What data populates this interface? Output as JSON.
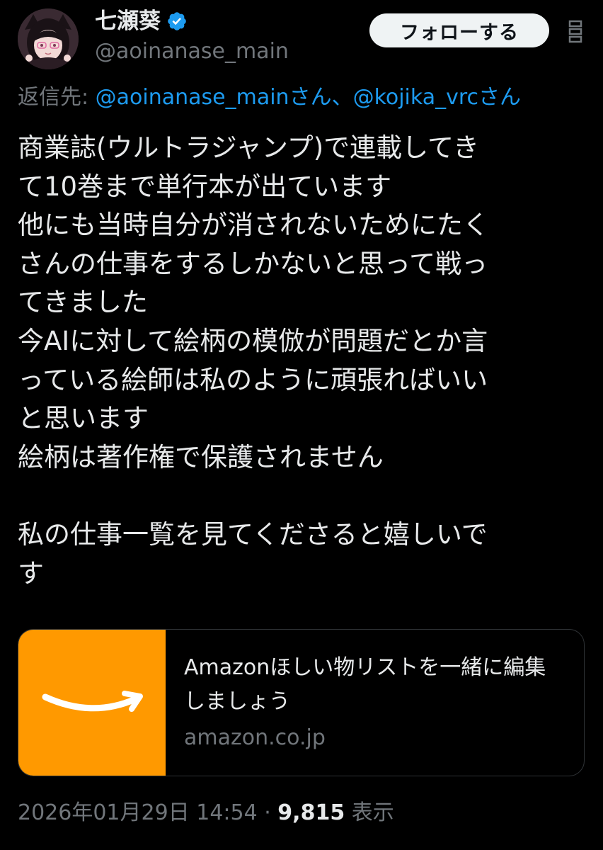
{
  "author": {
    "display_name": "七瀬葵",
    "handle": "@aoinanase_main",
    "verified": true,
    "avatar_icon": "avatar-image"
  },
  "header": {
    "follow_label": "フォローする",
    "more_icon": "more-icon"
  },
  "reply_to": {
    "prefix": "返信先: ",
    "mentions": "@aoinanase_mainさん、@kojika_vrcさん"
  },
  "tweet": {
    "text": "商業誌(ウルトラジャンプ)で連載してき\nて10巻まで単行本が出ています\n他にも当時自分が消されないためにたく\nさんの仕事をするしかないと思って戦っ\nてきました\n今AIに対して絵柄の模倣が問題だとか言\nっている絵師は私のように頑張ればいい\nと思います\n絵柄は著作権で保護されません\n\n私の仕事一覧を見てくださると嬉しいで\nす"
  },
  "link_card": {
    "title": "Amazonほしい物リストを一緒に編集しましょう",
    "domain": "amazon.co.jp",
    "thumbnail_icon": "amazon-smile-logo",
    "thumbnail_color": "#ff9900"
  },
  "meta": {
    "timestamp": "2026年01月29日 14:54",
    "separator": " · ",
    "views_count": "9,815",
    "views_label": " 表示"
  },
  "colors": {
    "background": "#000000",
    "text_primary": "#e7e9ea",
    "text_secondary": "#71767b",
    "link": "#1d9bf0",
    "verified_badge": "#1d9bf0",
    "follow_button_bg": "#eff3f4"
  }
}
